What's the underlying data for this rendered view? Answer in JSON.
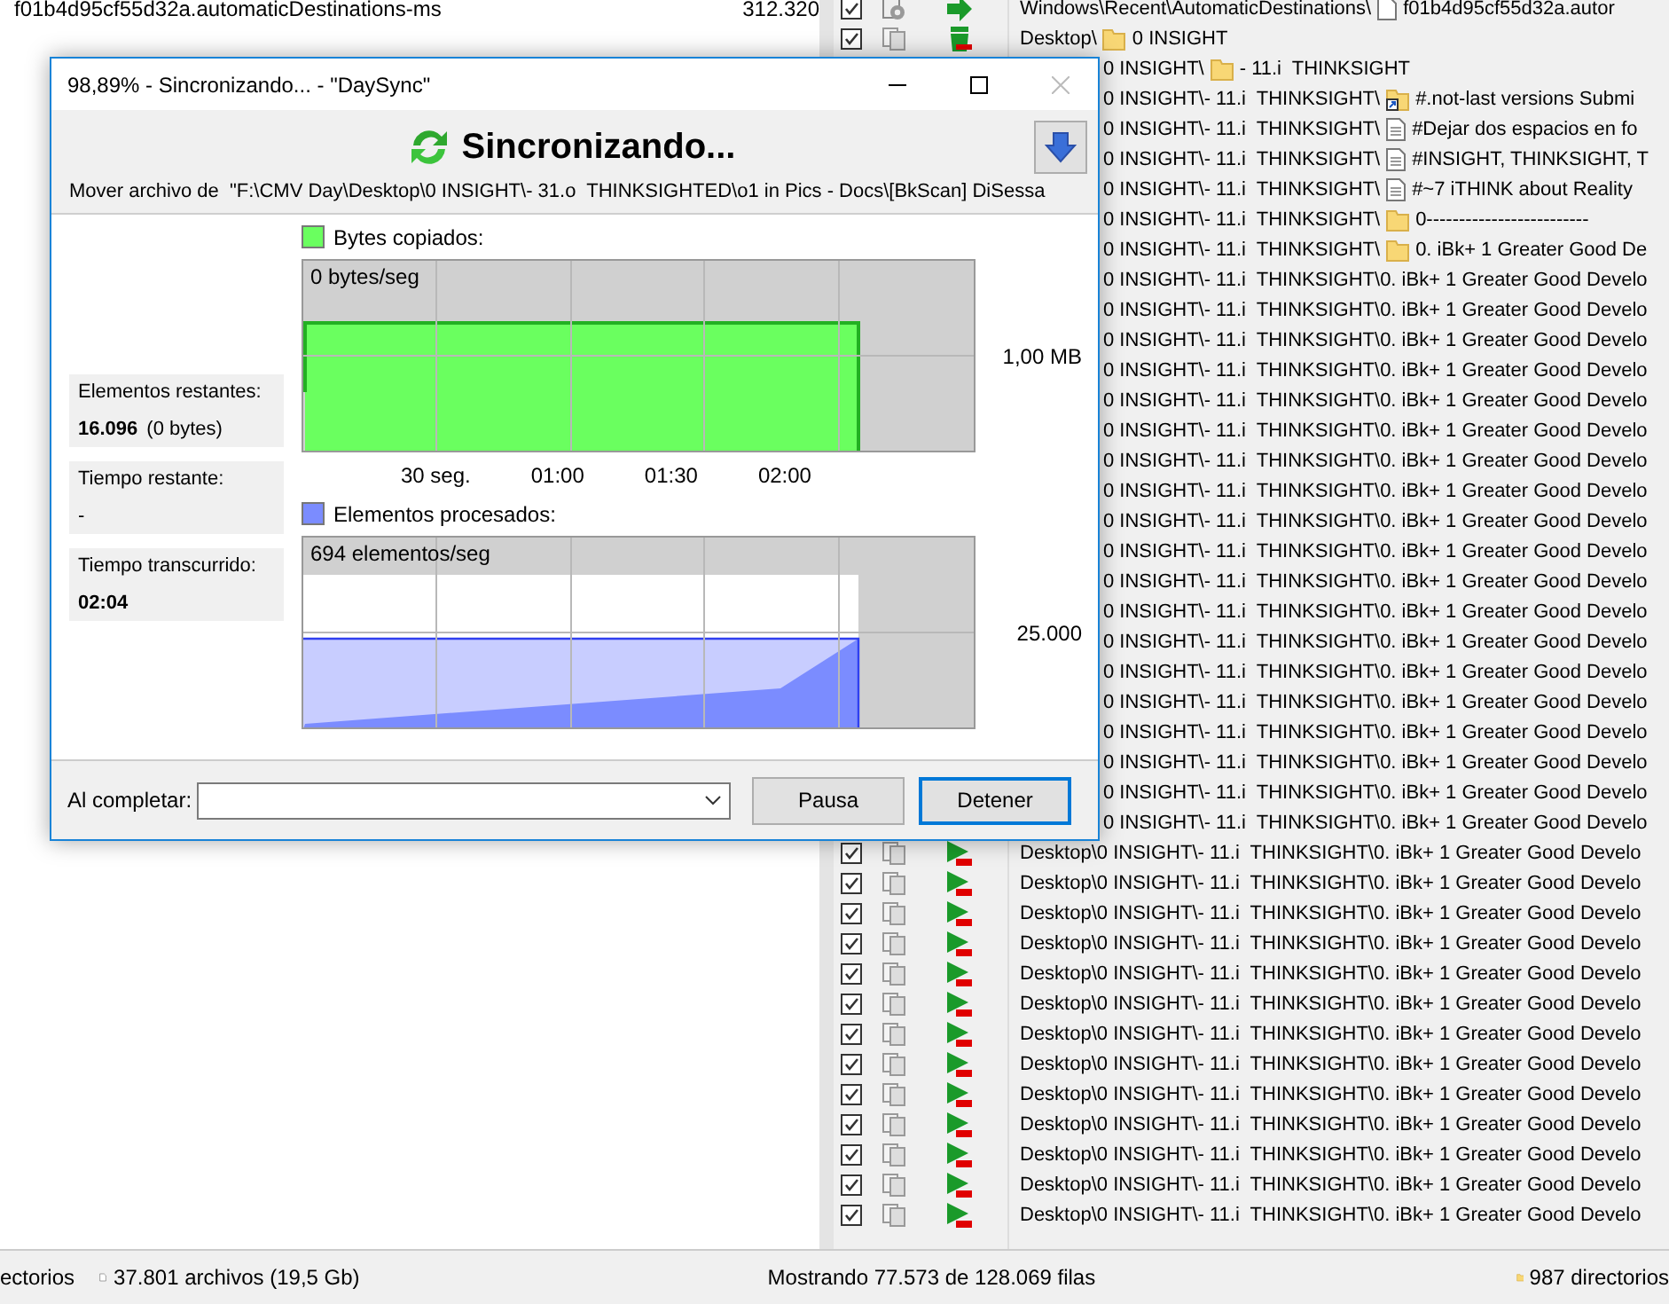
{
  "left_pane": {
    "rows": [
      {
        "name": "f01b4d95cf55d32a.automaticDestinations-ms",
        "size": "312.320"
      }
    ]
  },
  "list": {
    "rows": [
      {
        "checked": true,
        "kind": "file",
        "path": "Windows\\Recent\\AutomaticDestinations\\",
        "item": "f01b4d95cf55d32a.autor"
      },
      {
        "checked": true,
        "kind": "folder",
        "path": "Desktop\\",
        "item": "0 INSIGHT"
      },
      {
        "kind": "folder",
        "path": "0 INSIGHT\\",
        "item": "- 11.i  THINKSIGHT"
      },
      {
        "kind": "shortcut",
        "path": "0 INSIGHT\\- 11.i  THINKSIGHT\\",
        "item": "#.not-last versions Submi"
      },
      {
        "kind": "document",
        "path": "0 INSIGHT\\- 11.i  THINKSIGHT\\",
        "item": "#Dejar dos espacios en fo"
      },
      {
        "kind": "document",
        "path": "0 INSIGHT\\- 11.i  THINKSIGHT\\",
        "item": "#INSIGHT, THINKSIGHT, T"
      },
      {
        "kind": "document",
        "path": "0 INSIGHT\\- 11.i  THINKSIGHT\\",
        "item": "#~7 iTHINK about Reality"
      },
      {
        "kind": "folder",
        "path": "0 INSIGHT\\- 11.i  THINKSIGHT\\",
        "item": "0-------------------------"
      },
      {
        "kind": "folder",
        "path": "0 INSIGHT\\- 11.i  THINKSIGHT\\",
        "item": "0. iBk+ 1 Greater Good De"
      },
      {
        "kind": "path",
        "path": "0 INSIGHT\\- 11.i  THINKSIGHT\\0. iBk+ 1 Greater Good Develo"
      },
      {
        "kind": "path",
        "path": "0 INSIGHT\\- 11.i  THINKSIGHT\\0. iBk+ 1 Greater Good Develo"
      },
      {
        "kind": "path",
        "path": "0 INSIGHT\\- 11.i  THINKSIGHT\\0. iBk+ 1 Greater Good Develo"
      },
      {
        "kind": "path",
        "path": "0 INSIGHT\\- 11.i  THINKSIGHT\\0. iBk+ 1 Greater Good Develo"
      },
      {
        "kind": "path",
        "path": "0 INSIGHT\\- 11.i  THINKSIGHT\\0. iBk+ 1 Greater Good Develo"
      },
      {
        "kind": "path",
        "path": "0 INSIGHT\\- 11.i  THINKSIGHT\\0. iBk+ 1 Greater Good Develo"
      },
      {
        "kind": "path",
        "path": "0 INSIGHT\\- 11.i  THINKSIGHT\\0. iBk+ 1 Greater Good Develo"
      },
      {
        "kind": "path",
        "path": "0 INSIGHT\\- 11.i  THINKSIGHT\\0. iBk+ 1 Greater Good Develo"
      },
      {
        "kind": "path",
        "path": "0 INSIGHT\\- 11.i  THINKSIGHT\\0. iBk+ 1 Greater Good Develo"
      },
      {
        "kind": "path",
        "path": "0 INSIGHT\\- 11.i  THINKSIGHT\\0. iBk+ 1 Greater Good Develo"
      },
      {
        "kind": "path",
        "path": "0 INSIGHT\\- 11.i  THINKSIGHT\\0. iBk+ 1 Greater Good Develo"
      },
      {
        "kind": "path",
        "path": "0 INSIGHT\\- 11.i  THINKSIGHT\\0. iBk+ 1 Greater Good Develo"
      },
      {
        "kind": "path",
        "path": "0 INSIGHT\\- 11.i  THINKSIGHT\\0. iBk+ 1 Greater Good Develo"
      },
      {
        "kind": "path",
        "path": "0 INSIGHT\\- 11.i  THINKSIGHT\\0. iBk+ 1 Greater Good Develo"
      },
      {
        "kind": "path",
        "path": "0 INSIGHT\\- 11.i  THINKSIGHT\\0. iBk+ 1 Greater Good Develo"
      },
      {
        "kind": "path",
        "path": "0 INSIGHT\\- 11.i  THINKSIGHT\\0. iBk+ 1 Greater Good Develo"
      },
      {
        "kind": "path",
        "path": "0 INSIGHT\\- 11.i  THINKSIGHT\\0. iBk+ 1 Greater Good Develo"
      },
      {
        "kind": "path",
        "path": "0 INSIGHT\\- 11.i  THINKSIGHT\\0. iBk+ 1 Greater Good Develo"
      },
      {
        "kind": "path",
        "path": "0 INSIGHT\\- 11.i  THINKSIGHT\\0. iBk+ 1 Greater Good Develo"
      },
      {
        "checked": true,
        "kind": "path",
        "path": "Desktop\\0 INSIGHT\\- 11.i  THINKSIGHT\\0. iBk+ 1 Greater Good Develo"
      },
      {
        "checked": true,
        "kind": "path",
        "path": "Desktop\\0 INSIGHT\\- 11.i  THINKSIGHT\\0. iBk+ 1 Greater Good Develo"
      },
      {
        "checked": true,
        "kind": "path",
        "path": "Desktop\\0 INSIGHT\\- 11.i  THINKSIGHT\\0. iBk+ 1 Greater Good Develo"
      },
      {
        "checked": true,
        "kind": "path",
        "path": "Desktop\\0 INSIGHT\\- 11.i  THINKSIGHT\\0. iBk+ 1 Greater Good Develo"
      },
      {
        "checked": true,
        "kind": "path",
        "path": "Desktop\\0 INSIGHT\\- 11.i  THINKSIGHT\\0. iBk+ 1 Greater Good Develo"
      },
      {
        "checked": true,
        "kind": "path",
        "path": "Desktop\\0 INSIGHT\\- 11.i  THINKSIGHT\\0. iBk+ 1 Greater Good Develo"
      },
      {
        "checked": true,
        "kind": "path",
        "path": "Desktop\\0 INSIGHT\\- 11.i  THINKSIGHT\\0. iBk+ 1 Greater Good Develo"
      },
      {
        "checked": true,
        "kind": "path",
        "path": "Desktop\\0 INSIGHT\\- 11.i  THINKSIGHT\\0. iBk+ 1 Greater Good Develo"
      },
      {
        "checked": true,
        "kind": "path",
        "path": "Desktop\\0 INSIGHT\\- 11.i  THINKSIGHT\\0. iBk+ 1 Greater Good Develo"
      },
      {
        "checked": true,
        "kind": "path",
        "path": "Desktop\\0 INSIGHT\\- 11.i  THINKSIGHT\\0. iBk+ 1 Greater Good Develo"
      },
      {
        "checked": true,
        "kind": "path",
        "path": "Desktop\\0 INSIGHT\\- 11.i  THINKSIGHT\\0. iBk+ 1 Greater Good Develo"
      },
      {
        "checked": true,
        "kind": "path",
        "path": "Desktop\\0 INSIGHT\\- 11.i  THINKSIGHT\\0. iBk+ 1 Greater Good Develo"
      },
      {
        "checked": true,
        "kind": "path",
        "path": "Desktop\\0 INSIGHT\\- 11.i  THINKSIGHT\\0. iBk+ 1 Greater Good Develo"
      }
    ]
  },
  "status_bar": {
    "left_cut": "ectorios",
    "files": "37.801 archivos (19,5 Gb)",
    "showing": "Mostrando 77.573 de 128.069 filas",
    "dirs": "987 directorios"
  },
  "dialog": {
    "title": "98,89% - Sincronizando... - \"DaySync\"",
    "close_disabled": true,
    "heading": "Sincronizando...",
    "subtitle": "Mover archivo de  \"F:\\CMV Day\\Desktop\\0 INSIGHT\\- 31.o  THINKSIGHTED\\o1 in Pics - Docs\\[BkScan] DiSessa",
    "stats": [
      {
        "label": "Elementos restantes:",
        "value": "16.096",
        "bold": true,
        "extra": "(0 bytes)"
      },
      {
        "label": "Tiempo restante:",
        "value": "-",
        "bold": false
      },
      {
        "label": "Tiempo transcurrido:",
        "value": "02:04",
        "bold": true
      }
    ],
    "graphs": [
      {
        "kind": "bytes",
        "legend": "Bytes copiados:",
        "rate": "0 bytes/seg",
        "scale": "1,00 MB",
        "color": "#6aff5f",
        "times": [
          "30 seg.",
          "01:00",
          "01:30",
          "02:00"
        ]
      },
      {
        "kind": "items",
        "legend": "Elementos procesados:",
        "rate": "694 elementos/seg",
        "scale": "25.000",
        "color": "#7b8cff"
      }
    ],
    "on_complete_label": "Al completar:",
    "buttons": [
      {
        "label": "Pausa",
        "selected": false
      },
      {
        "label": "Detener",
        "selected": true
      }
    ]
  }
}
